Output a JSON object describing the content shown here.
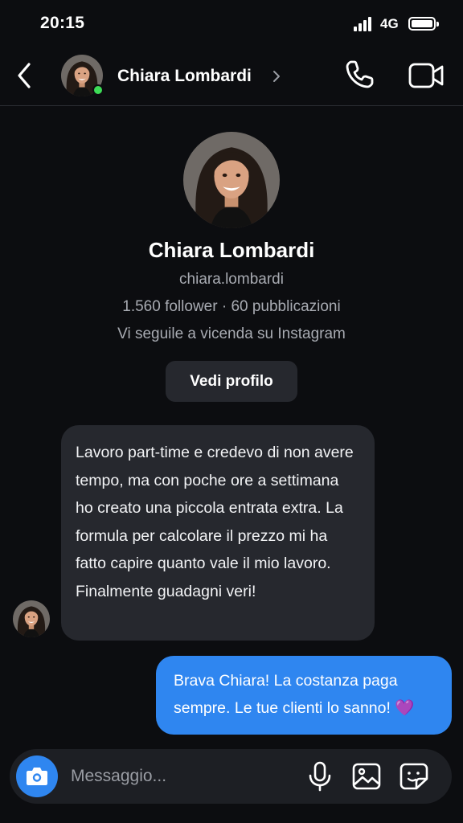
{
  "status_bar": {
    "time": "20:15",
    "network": "4G"
  },
  "header": {
    "contact_name": "Chiara Lombardi",
    "online": true,
    "icons": {
      "back": "chevron-left-icon",
      "call": "phone-icon",
      "video": "video-camera-icon"
    }
  },
  "profile": {
    "name": "Chiara Lombardi",
    "username": "chiara.lombardi",
    "stats": "1.560 follower · 60 pubblicazioni",
    "mutual": "Vi seguile a vicenda su Instagram",
    "view_button": "Vedi profilo"
  },
  "messages": [
    {
      "direction": "incoming",
      "text": "Lavoro part-time e credevo di non avere tempo, ma con poche ore a settimana ho creato una piccola entrata extra. La formula per calcolare il prezzo mi ha fatto capire quanto vale il mio lavoro. Finalmente guadagni veri!"
    },
    {
      "direction": "outgoing",
      "text": "Brava Chiara! La costanza paga sempre. Le tue clienti lo sanno! 💜"
    }
  ],
  "composer": {
    "placeholder": "Messaggio...",
    "icons": [
      "camera-icon",
      "microphone-icon",
      "gallery-icon",
      "sticker-icon"
    ]
  },
  "colors": {
    "background": "#0c0d10",
    "incoming_bubble": "#26282e",
    "outgoing_bubble": "#2f86f0",
    "online_dot": "#3ddc56",
    "secondary_text": "#a8abb2"
  }
}
